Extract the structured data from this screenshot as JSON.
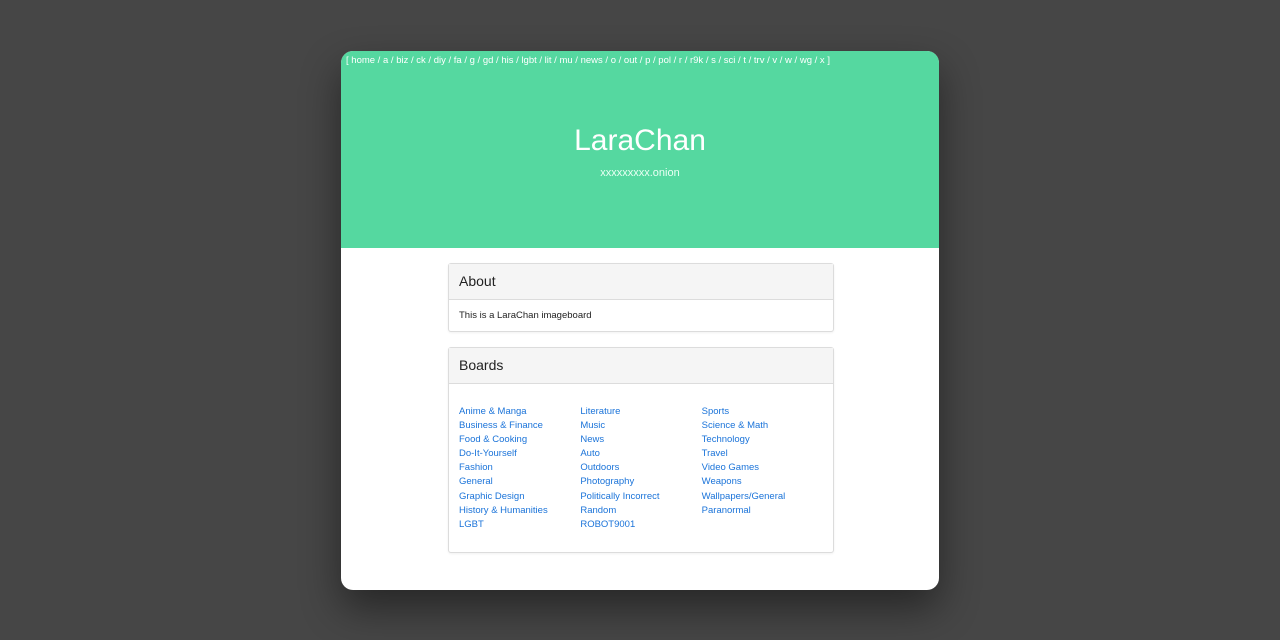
{
  "header": {
    "nav_open": "[",
    "nav_close": "]",
    "nav_links": [
      "home",
      "a",
      "biz",
      "ck",
      "diy",
      "fa",
      "g",
      "gd",
      "his",
      "lgbt",
      "lit",
      "mu",
      "news",
      "o",
      "out",
      "p",
      "pol",
      "r",
      "r9k",
      "s",
      "sci",
      "t",
      "trv",
      "v",
      "w",
      "wg",
      "x"
    ],
    "title": "LaraChan",
    "subtitle": "xxxxxxxxx.onion"
  },
  "about": {
    "heading": "About",
    "text": "This is a LaraChan imageboard"
  },
  "boards": {
    "heading": "Boards",
    "columns": [
      [
        "Anime & Manga",
        "Business & Finance",
        "Food & Cooking",
        "Do-It-Yourself",
        "Fashion",
        "General",
        "Graphic Design",
        "History & Humanities",
        "LGBT"
      ],
      [
        "Literature",
        "Music",
        "News",
        "Auto",
        "Outdoors",
        "Photography",
        "Politically Incorrect",
        "Random",
        "ROBOT9001"
      ],
      [
        "Sports",
        "Science & Math",
        "Technology",
        "Travel",
        "Video Games",
        "Weapons",
        "Wallpapers/General",
        "Paranormal"
      ]
    ]
  },
  "colors": {
    "hero": "#55d8a0",
    "link": "#1a73d9",
    "backdrop": "#464646"
  }
}
